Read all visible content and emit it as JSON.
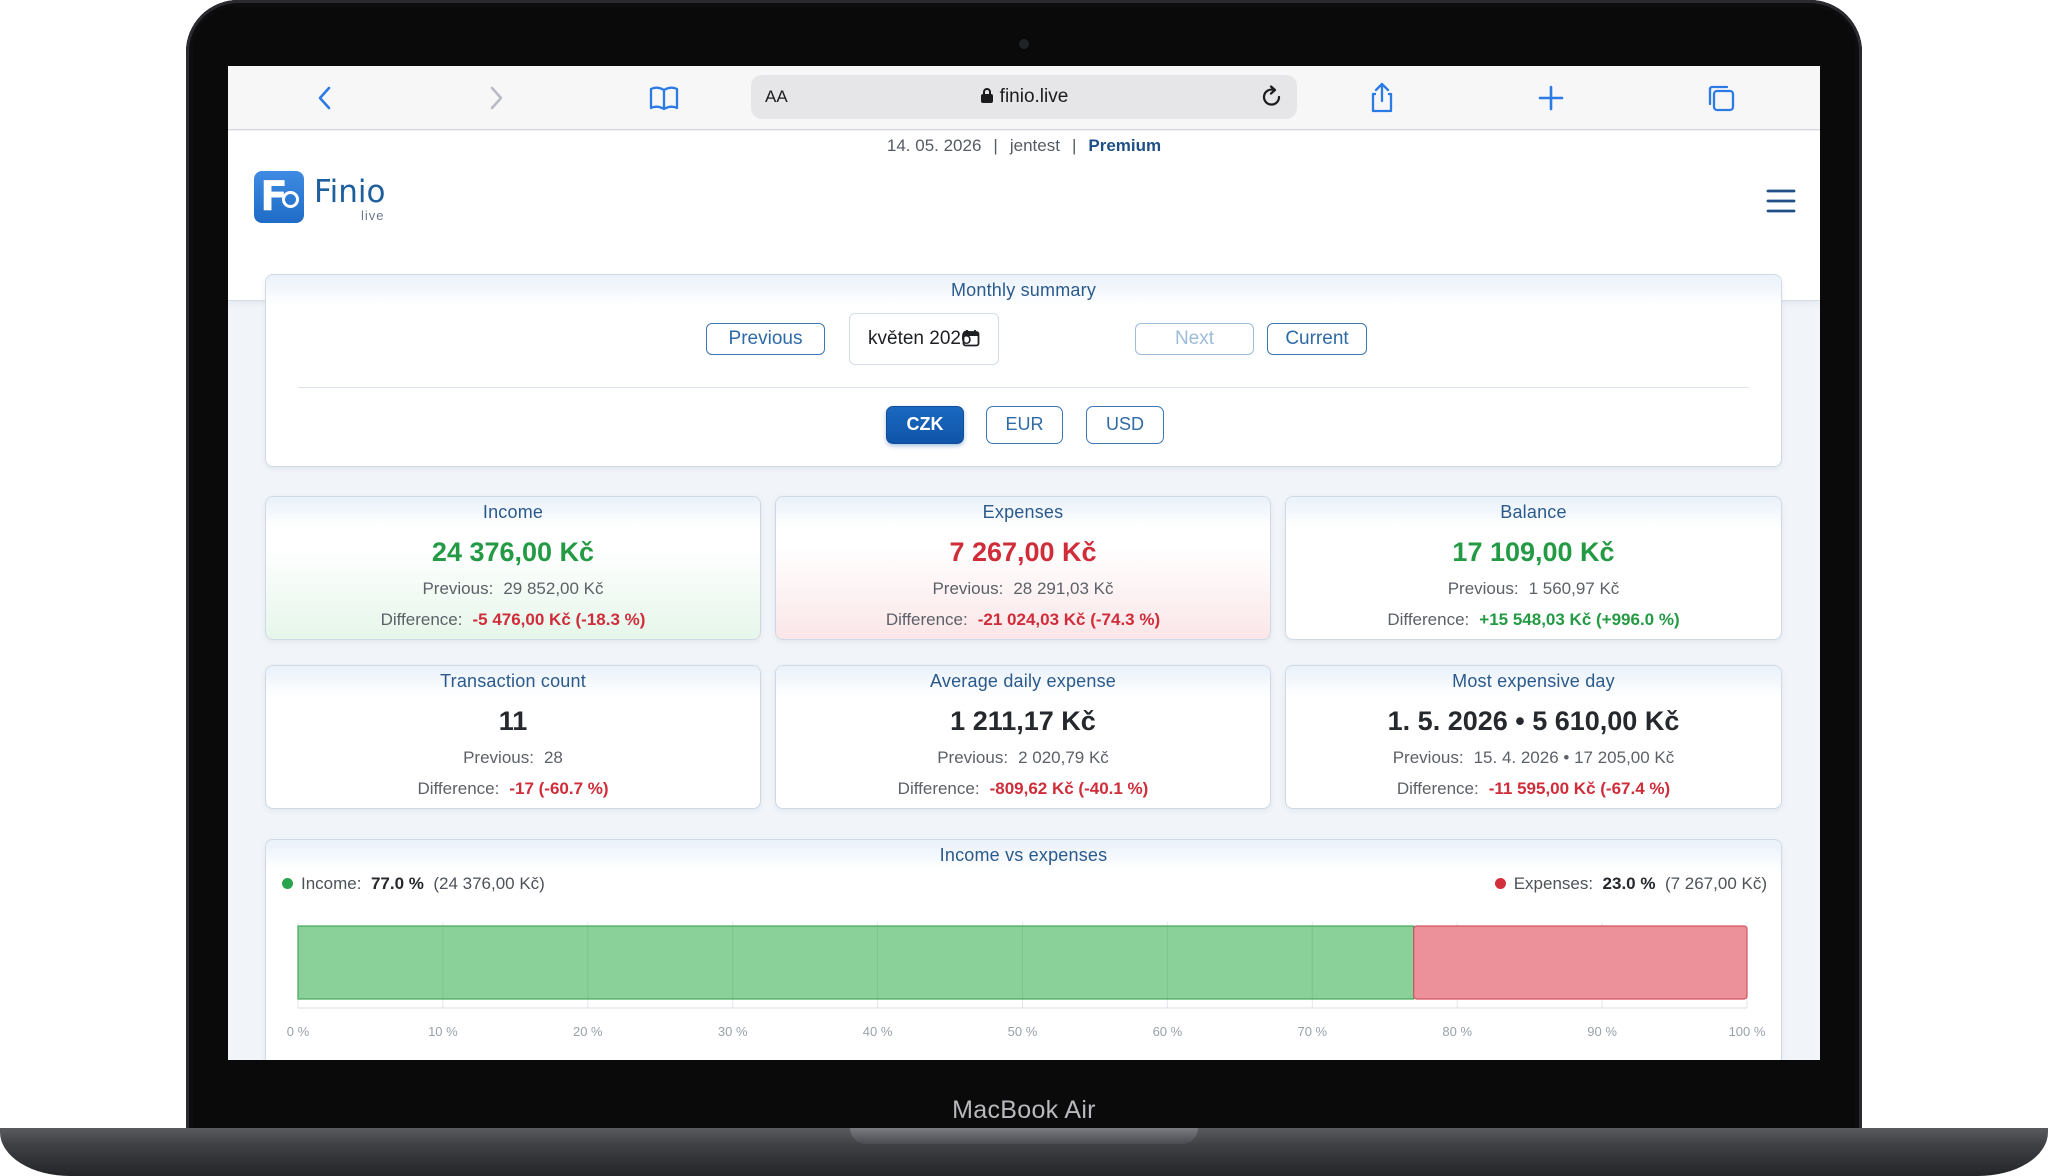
{
  "device": {
    "label": "MacBook Air"
  },
  "browser": {
    "url_text_size": "AA",
    "url": "finio.live"
  },
  "header": {
    "date": "14. 05. 2026",
    "user": "jentest",
    "plan": "Premium",
    "separator": "|",
    "logo_name": "Finio",
    "logo_sub": "live"
  },
  "monthly_summary": {
    "title": "Monthly summary",
    "previous_label": "Previous",
    "month_value": "květen 2026",
    "next_label": "Next",
    "current_label": "Current",
    "currencies": [
      "CZK",
      "EUR",
      "USD"
    ],
    "active_currency": "CZK"
  },
  "stats": [
    {
      "title": "Income",
      "value": "24 376,00 Kč",
      "previous_label": "Previous:",
      "previous": "29 852,00 Kč",
      "difference_label": "Difference:",
      "difference": "-5 476,00 Kč (-18.3 %)"
    },
    {
      "title": "Expenses",
      "value": "7 267,00 Kč",
      "previous_label": "Previous:",
      "previous": "28 291,03 Kč",
      "difference_label": "Difference:",
      "difference": "-21 024,03 Kč (-74.3 %)"
    },
    {
      "title": "Balance",
      "value": "17 109,00 Kč",
      "previous_label": "Previous:",
      "previous": "1 560,97 Kč",
      "difference_label": "Difference:",
      "difference": "+15 548,03 Kč (+996.0 %)"
    },
    {
      "title": "Transaction count",
      "value": "11",
      "previous_label": "Previous:",
      "previous": "28",
      "difference_label": "Difference:",
      "difference": "-17 (-60.7 %)"
    },
    {
      "title": "Average daily expense",
      "value": "1 211,17 Kč",
      "previous_label": "Previous:",
      "previous": "2 020,79 Kč",
      "difference_label": "Difference:",
      "difference": "-809,62 Kč (-40.1 %)"
    },
    {
      "title": "Most expensive day",
      "value": "1. 5. 2026 • 5 610,00 Kč",
      "previous_label": "Previous:",
      "previous": "15. 4. 2026 • 17 205,00 Kč",
      "difference_label": "Difference:",
      "difference": "-11 595,00 Kč (-67.4 %)"
    }
  ],
  "colors": {
    "income": "#8ad199",
    "income_stroke": "#45a75c",
    "expense": "#ec9099",
    "expense_stroke": "#d25563",
    "legend_income_dot": "#2aa44c",
    "legend_expense_dot": "#d3303d"
  },
  "chart_data": {
    "type": "bar",
    "title": "Income vs expenses",
    "orientation": "horizontal-stacked",
    "series": [
      {
        "name": "Income",
        "value": 77.0,
        "amount": "24 376,00 Kč"
      },
      {
        "name": "Expenses",
        "value": 23.0,
        "amount": "7 267,00 Kč"
      }
    ],
    "legend": {
      "income_label": "Income:",
      "income_pct": "77.0 %",
      "income_amount": "(24 376,00 Kč)",
      "expense_label": "Expenses:",
      "expense_pct": "23.0 %",
      "expense_amount": "(7 267,00 Kč)"
    },
    "xlim": [
      0,
      100
    ],
    "x_ticks": [
      0,
      10,
      20,
      30,
      40,
      50,
      60,
      70,
      80,
      90,
      100
    ],
    "x_tick_labels": [
      "0 %",
      "10 %",
      "20 %",
      "30 %",
      "40 %",
      "50 %",
      "60 %",
      "70 %",
      "80 %",
      "90 %",
      "100 %"
    ],
    "grid": true
  }
}
